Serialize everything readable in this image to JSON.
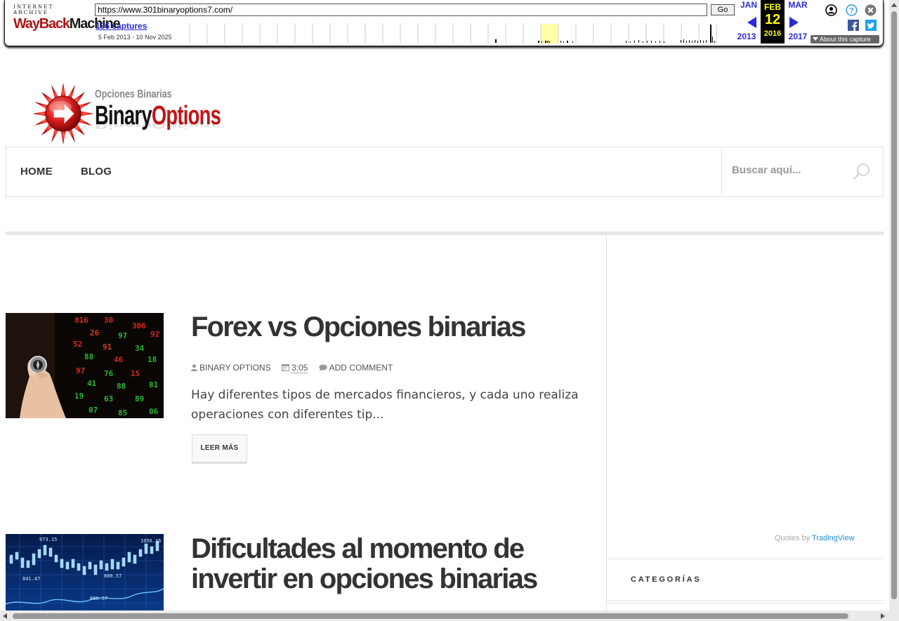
{
  "wayback": {
    "logo_top": "INTERNET ARCHIVE",
    "logo_main_1": "WayBack",
    "logo_main_2": "Machine",
    "url": "https://www.301binaryoptions7.com/",
    "go_label": "Go",
    "captures": "136 captures",
    "date_range": "5 Feb 2013 - 10 Nov 2025",
    "prev_month": "JAN",
    "cur_month": "FEB",
    "next_month": "MAR",
    "cur_day": "12",
    "prev_year": "2013",
    "cur_year": "2016",
    "next_year": "2017",
    "about": "About this capture",
    "icons": [
      "account-icon",
      "help-icon",
      "close-icon",
      "facebook-icon",
      "twitter-icon"
    ]
  },
  "site": {
    "logo_sub": "Opciones Binarias",
    "logo_binary": "Binary",
    "logo_options": "Options",
    "nav": [
      "HOME",
      "BLOG"
    ],
    "search_placeholder": "Buscar aquí..."
  },
  "posts": [
    {
      "title": "Forex vs Opciones binarias",
      "author": "BINARY OPTIONS",
      "time": "3:05",
      "comments": "ADD COMMENT",
      "excerpt": "Hay diferentes tipos de mercados financieros, y cada uno realiza operaciones con diferentes tip...",
      "read_more": "LEER MÁS"
    },
    {
      "title": "Dificultades al momento de invertir en opciones binarias"
    }
  ],
  "sidebar": {
    "quotes_by": "Quotes by",
    "tradingview": "TradingView",
    "categories_title": "CATEGORÍAS"
  },
  "colors": {
    "accent_red": "#c41414",
    "wayback_blue": "#2a2ad8",
    "tradingview_blue": "#2a8fd1"
  }
}
